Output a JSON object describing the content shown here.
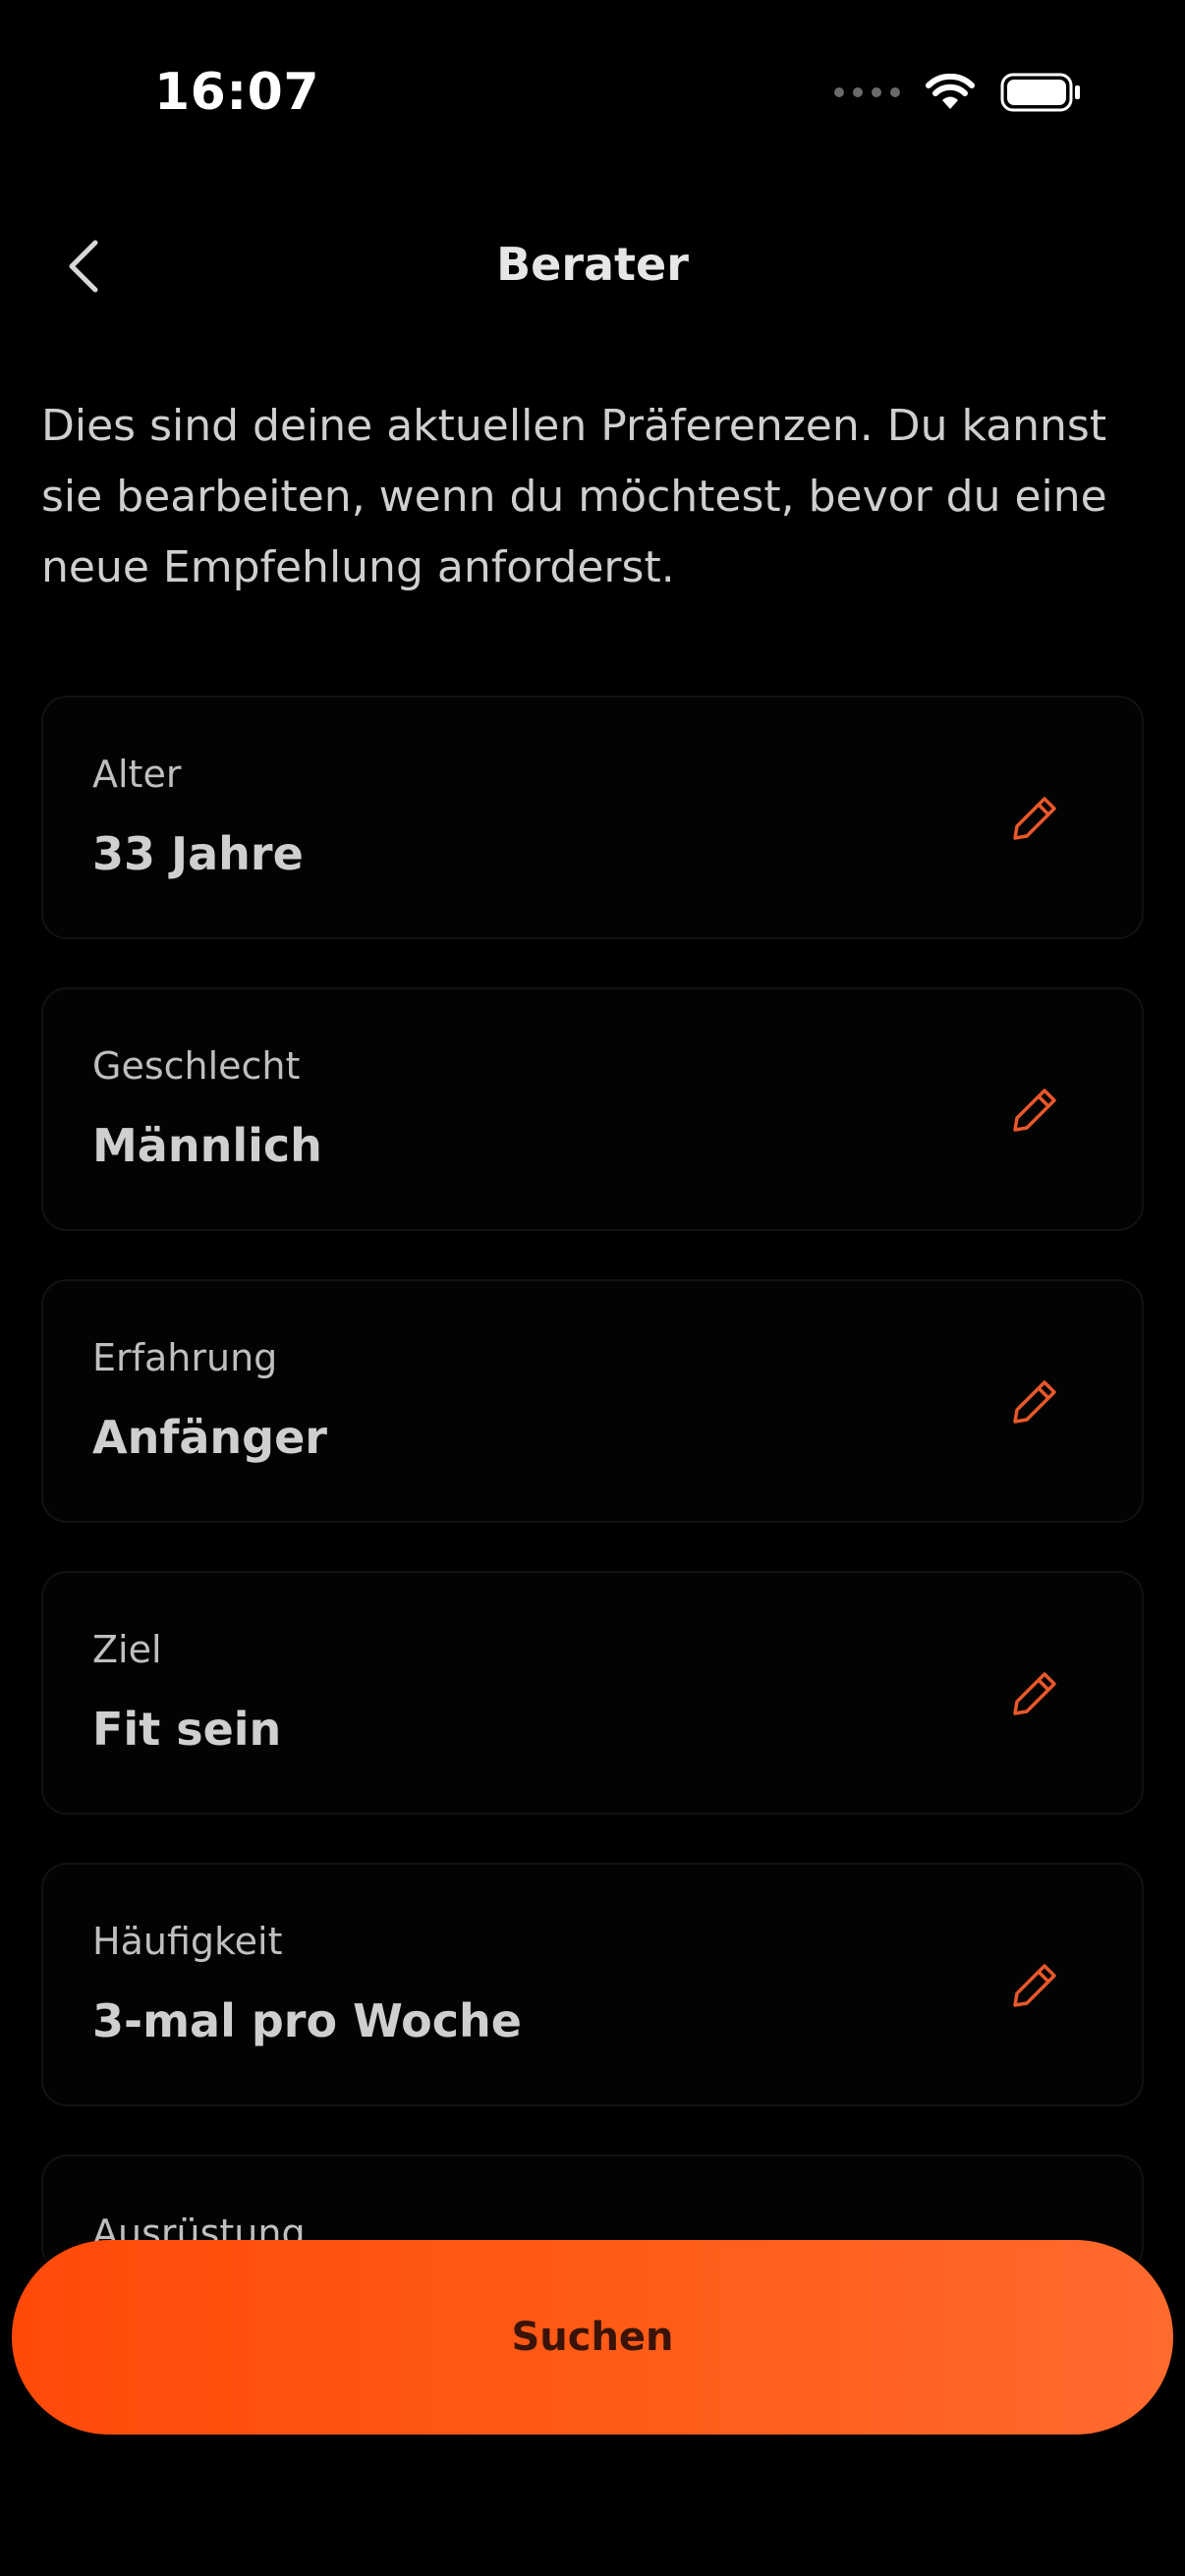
{
  "status_bar": {
    "time": "16:07"
  },
  "nav": {
    "title": "Berater"
  },
  "intro": {
    "text": "Dies sind deine aktuellen Präferenzen. Du kannst sie bearbeiten, wenn du möchtest, bevor du eine neue Empfehlung anforderst."
  },
  "preferences": [
    {
      "label": "Alter",
      "value": "33 Jahre"
    },
    {
      "label": "Geschlecht",
      "value": "Männlich"
    },
    {
      "label": "Erfahrung",
      "value": "Anfänger"
    },
    {
      "label": "Ziel",
      "value": "Fit sein"
    },
    {
      "label": "Häufigkeit",
      "value": "3-mal pro Woche"
    },
    {
      "label": "Ausrüstung",
      "value": ""
    }
  ],
  "actions": {
    "search_label": "Suchen"
  },
  "colors": {
    "accent": "#ff5a16",
    "background": "#000000",
    "edit_icon": "#e9582a"
  },
  "icons": {
    "back": "chevron-left-icon",
    "edit": "pencil-icon",
    "wifi": "wifi-icon",
    "battery": "battery-icon"
  }
}
